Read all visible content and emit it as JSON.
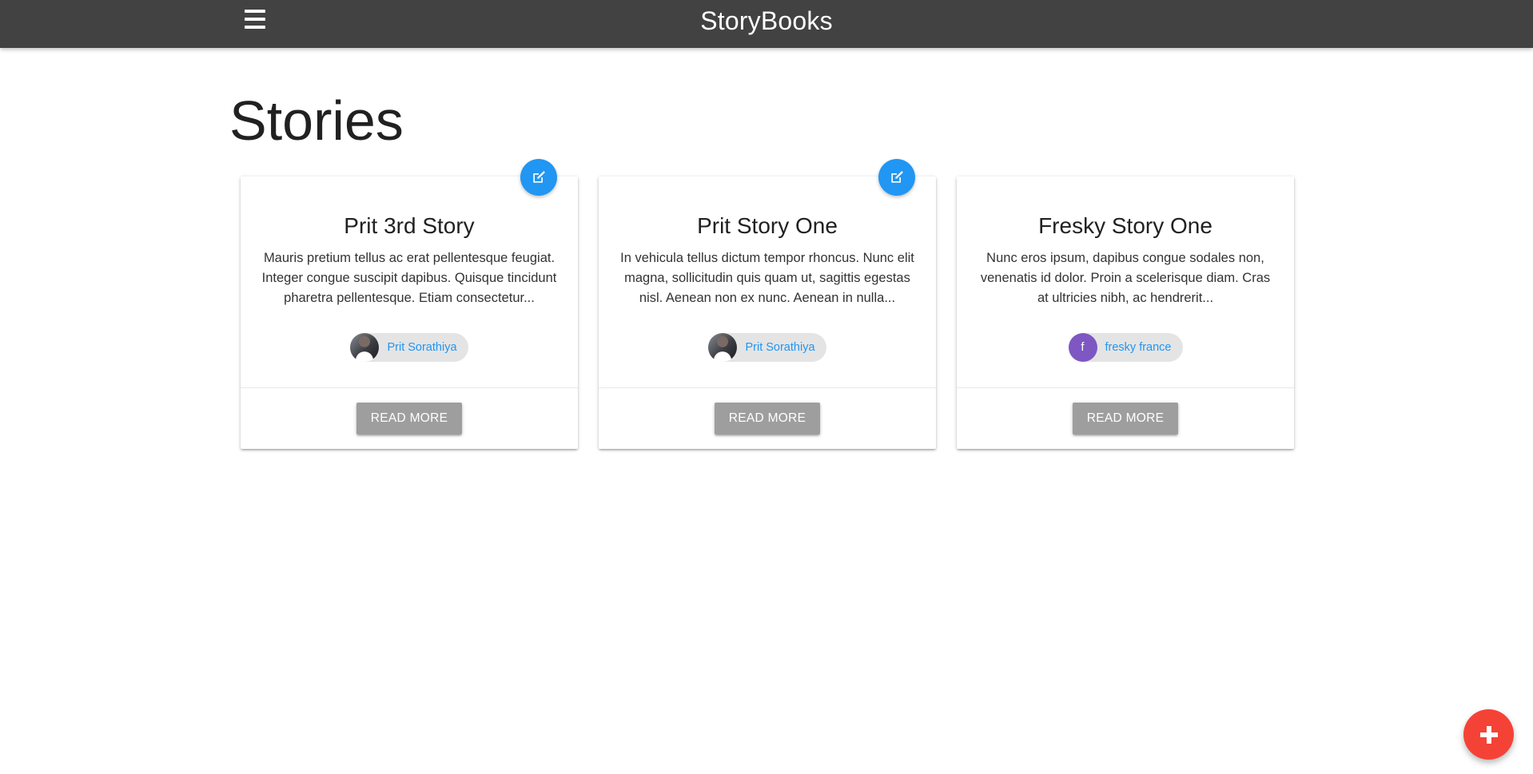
{
  "navbar": {
    "brand": "StoryBooks",
    "menu_icon": "hamburger-menu-icon",
    "background": "#424242"
  },
  "page": {
    "title": "Stories"
  },
  "stories": [
    {
      "title": "Prit 3rd Story",
      "excerpt": "Mauris pretium tellus ac erat pellentesque feugiat. Integer congue suscipit dapibus. Quisque tincidunt pharetra pellentesque. Etiam consectetur...",
      "author": "Prit Sorathiya",
      "avatar": "photo",
      "editable": true,
      "read_more": "Read More"
    },
    {
      "title": "Prit Story One",
      "excerpt": "In vehicula tellus dictum tempor rhoncus. Nunc elit magna, sollicitudin quis quam ut, sagittis egestas nisl. Aenean non ex nunc. Aenean in nulla...",
      "author": "Prit Sorathiya",
      "avatar": "photo",
      "editable": true,
      "read_more": "Read More"
    },
    {
      "title": "Fresky Story One",
      "excerpt": "Nunc eros ipsum, dapibus congue sodales non, venenatis id dolor. Proin a scelerisque diam. Cras at ultricies nibh, ac hendrerit...",
      "author": "fresky france",
      "avatar": "f",
      "editable": false,
      "read_more": "Read More"
    }
  ],
  "colors": {
    "edit_button": "#2196f3",
    "fab": "#f44336",
    "read_more_button": "#9e9e9e",
    "author_link": "#2196f3",
    "letter_avatar": "#7e57c2"
  },
  "icons": {
    "edit": "edit-icon",
    "add": "plus-icon"
  }
}
